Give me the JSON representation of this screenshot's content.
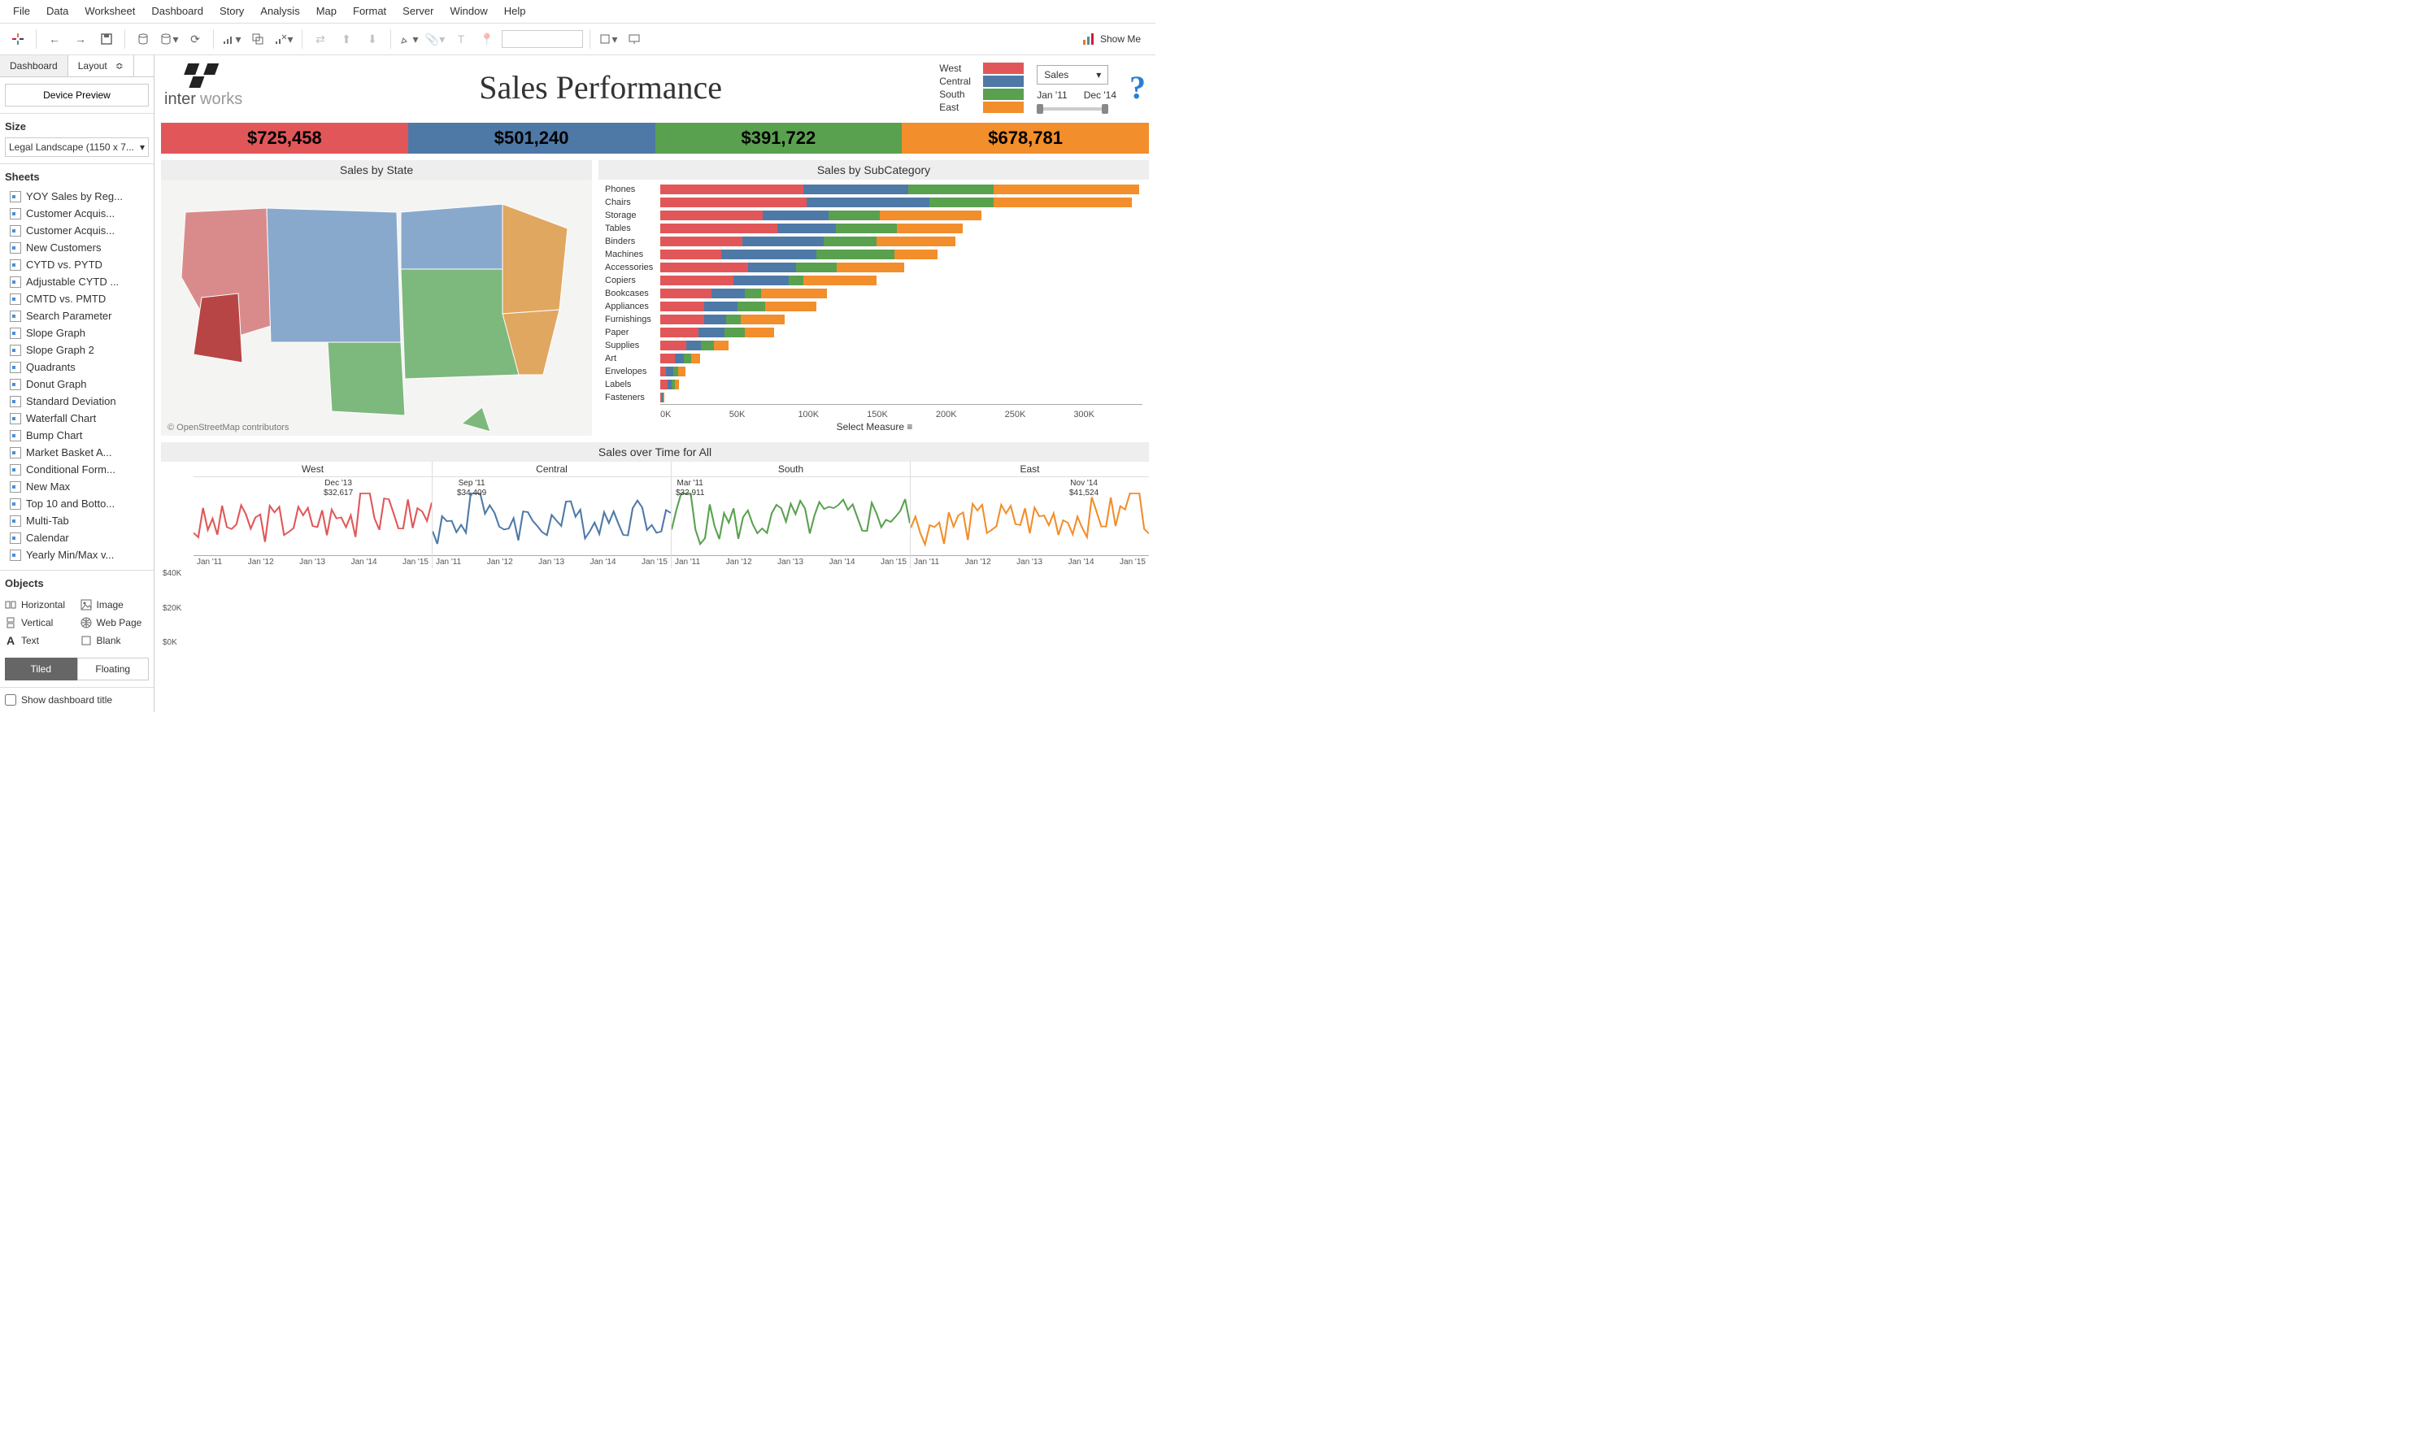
{
  "menu": [
    "File",
    "Data",
    "Worksheet",
    "Dashboard",
    "Story",
    "Analysis",
    "Map",
    "Format",
    "Server",
    "Window",
    "Help"
  ],
  "showme": "Show Me",
  "sidebar": {
    "tabs": {
      "dashboard": "Dashboard",
      "layout": "Layout"
    },
    "device_preview": "Device Preview",
    "size_header": "Size",
    "size_value": "Legal Landscape (1150 x 7...",
    "sheets_header": "Sheets",
    "sheets": [
      "YOY Sales by Reg...",
      "Customer Acquis...",
      "Customer Acquis...",
      "New Customers",
      "CYTD vs. PYTD",
      "Adjustable CYTD ...",
      "CMTD vs. PMTD",
      "Search Parameter",
      "Slope Graph",
      "Slope Graph 2",
      "Quadrants",
      "Donut Graph",
      "Standard Deviation",
      "Waterfall Chart",
      "Bump Chart",
      "Market Basket A...",
      "Conditional Form...",
      "New Max",
      "Top 10 and Botto...",
      "Multi-Tab",
      "Calendar",
      "Yearly Min/Max v..."
    ],
    "objects_header": "Objects",
    "objects": [
      {
        "icon": "layout-h",
        "label": "Horizontal"
      },
      {
        "icon": "image",
        "label": "Image"
      },
      {
        "icon": "layout-v",
        "label": "Vertical"
      },
      {
        "icon": "web",
        "label": "Web Page"
      },
      {
        "icon": "text",
        "label": "Text"
      },
      {
        "icon": "blank",
        "label": "Blank"
      }
    ],
    "tiled": "Tiled",
    "floating": "Floating",
    "show_title": "Show dashboard title"
  },
  "dashboard": {
    "title": "Sales Performance",
    "logo_text": "interworks",
    "legend": [
      {
        "name": "West",
        "class": "c-west"
      },
      {
        "name": "Central",
        "class": "c-central"
      },
      {
        "name": "South",
        "class": "c-south"
      },
      {
        "name": "East",
        "class": "c-east"
      }
    ],
    "measure_select": "Sales",
    "date_from": "Jan '11",
    "date_to": "Dec '14",
    "kpis": [
      {
        "value": "$725,458",
        "class": "c-west"
      },
      {
        "value": "$501,240",
        "class": "c-central"
      },
      {
        "value": "$391,722",
        "class": "c-south"
      },
      {
        "value": "$678,781",
        "class": "c-east"
      }
    ],
    "map_title": "Sales by State",
    "map_attr": "© OpenStreetMap contributors",
    "bars_title": "Sales by SubCategory",
    "select_measure": "Select Measure",
    "time_title": "Sales over Time for All",
    "time_subs": [
      "West",
      "Central",
      "South",
      "East"
    ],
    "time_ticks": [
      "Jan '11",
      "Jan '12",
      "Jan '13",
      "Jan '14",
      "Jan '15"
    ],
    "y_ticks": [
      "$40K",
      "$20K",
      "$0K"
    ],
    "callouts": [
      {
        "label": "Dec '13",
        "value": "$32,617"
      },
      {
        "label": "Sep '11",
        "value": "$34,409"
      },
      {
        "label": "Mar '11",
        "value": "$32,911"
      },
      {
        "label": "Nov '14",
        "value": "$41,524"
      }
    ]
  },
  "chart_data": {
    "kpi": {
      "West": 725458,
      "Central": 501240,
      "South": 391722,
      "East": 678781
    },
    "subcategory_bars": {
      "type": "bar",
      "title": "Sales by SubCategory",
      "xlabel": "Select Measure",
      "x_ticks": [
        "0K",
        "50K",
        "100K",
        "150K",
        "200K",
        "250K",
        "300K"
      ],
      "xlim": [
        0,
        330000
      ],
      "categories": [
        "Phones",
        "Chairs",
        "Storage",
        "Tables",
        "Binders",
        "Machines",
        "Accessories",
        "Copiers",
        "Bookcases",
        "Appliances",
        "Furnishings",
        "Paper",
        "Supplies",
        "Art",
        "Envelopes",
        "Labels",
        "Fasteners"
      ],
      "series": [
        {
          "name": "West",
          "color": "#e15759",
          "values": [
            98000,
            100000,
            70000,
            80000,
            56000,
            42000,
            60000,
            50000,
            35000,
            30000,
            30000,
            26000,
            18000,
            10000,
            4000,
            5000,
            1000
          ]
        },
        {
          "name": "Central",
          "color": "#4e79a7",
          "values": [
            72000,
            84000,
            45000,
            40000,
            56000,
            65000,
            33000,
            38000,
            23000,
            23000,
            15000,
            18000,
            10000,
            6000,
            5000,
            3000,
            800
          ]
        },
        {
          "name": "South",
          "color": "#59a14f",
          "values": [
            58000,
            44000,
            35000,
            42000,
            36000,
            53000,
            28000,
            10000,
            11000,
            19000,
            10000,
            14000,
            9000,
            5000,
            3000,
            2000,
            500
          ]
        },
        {
          "name": "East",
          "color": "#f28e2b",
          "values": [
            100000,
            95000,
            70000,
            45000,
            54000,
            30000,
            46000,
            50000,
            45000,
            35000,
            30000,
            20000,
            10000,
            6000,
            5000,
            3000,
            700
          ]
        }
      ]
    },
    "sales_over_time": {
      "type": "line",
      "title": "Sales over Time for All",
      "ylabel": "",
      "ylim": [
        0,
        45000
      ],
      "x_ticks": [
        "Jan '11",
        "Jan '12",
        "Jan '13",
        "Jan '14",
        "Jan '15"
      ],
      "panels": [
        {
          "name": "West",
          "color": "#e15759",
          "peak": {
            "label": "Dec '13",
            "value": 32617
          }
        },
        {
          "name": "Central",
          "color": "#4e79a7",
          "peak": {
            "label": "Sep '11",
            "value": 34409
          }
        },
        {
          "name": "South",
          "color": "#59a14f",
          "peak": {
            "label": "Mar '11",
            "value": 32911
          }
        },
        {
          "name": "East",
          "color": "#f28e2b",
          "peak": {
            "label": "Nov '14",
            "value": 41524
          }
        }
      ]
    }
  }
}
